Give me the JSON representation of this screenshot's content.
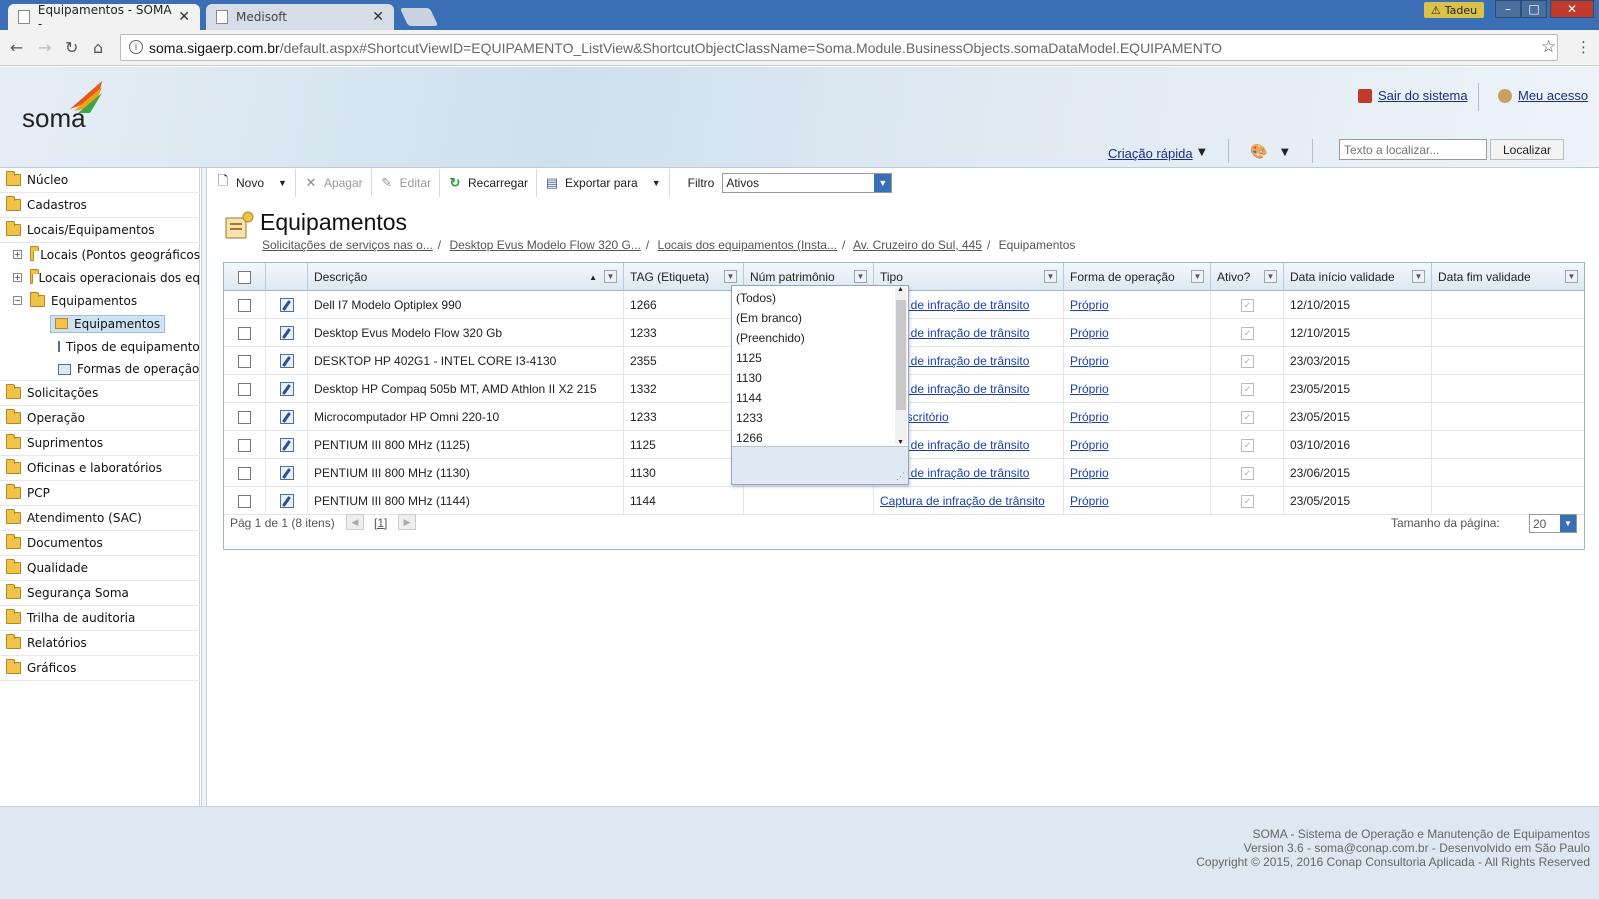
{
  "browser": {
    "tabs": [
      {
        "title": "Equipamentos - SOMA -",
        "close": "✕"
      },
      {
        "title": "Medisoft",
        "close": "✕"
      }
    ],
    "user": "Tadeu",
    "url_host": "soma.sigaerp.com.br",
    "url_path": "/default.aspx#ShortcutViewID=EQUIPAMENTO_ListView&ShortcutObjectClassName=Soma.Module.BusinessObjects.somaDataModel.EQUIPAMENTO"
  },
  "header": {
    "logo": "soma",
    "logout": "Sair do sistema",
    "my_access": "Meu acesso",
    "quick_create": "Criação rápida",
    "search_placeholder": "Texto a localizar...",
    "find_button": "Localizar"
  },
  "sidebar": {
    "items": [
      {
        "label": "Núcleo"
      },
      {
        "label": "Cadastros"
      },
      {
        "label": "Locais/Equipamentos"
      },
      {
        "label": "Locais (Pontos geográficos"
      },
      {
        "label": "Locais operacionais dos eq"
      },
      {
        "label": "Equipamentos"
      },
      {
        "label": "Equipamentos"
      },
      {
        "label": "Tipos de equipamentos"
      },
      {
        "label": "Formas de operação"
      },
      {
        "label": "Solicitações"
      },
      {
        "label": "Operação"
      },
      {
        "label": "Suprimentos"
      },
      {
        "label": "Oficinas e laboratórios"
      },
      {
        "label": "PCP"
      },
      {
        "label": "Atendimento (SAC)"
      },
      {
        "label": "Documentos"
      },
      {
        "label": "Qualidade"
      },
      {
        "label": "Segurança Soma"
      },
      {
        "label": "Trilha de auditoria"
      },
      {
        "label": "Relatórios"
      },
      {
        "label": "Gráficos"
      }
    ]
  },
  "toolbar": {
    "new": "Novo",
    "delete": "Apagar",
    "edit": "Editar",
    "reload": "Recarregar",
    "export": "Exportar para",
    "filter_label": "Filtro",
    "filter_value": "Ativos"
  },
  "page": {
    "title": "Equipamentos",
    "breadcrumbs": [
      "Solicitações de serviços nas o...",
      "Desktop Evus Modelo Flow 320 G...",
      "Locais dos equipamentos (Insta...",
      "Av. Cruzeiro do Sul, 445"
    ],
    "breadcrumb_current": "Equipamentos"
  },
  "grid": {
    "columns": [
      "Descrição",
      "TAG (Etiqueta)",
      "Núm patrimônio",
      "Tipo",
      "Forma de operação",
      "Ativo?",
      "Data início validade",
      "Data fim validade"
    ],
    "rows": [
      {
        "desc": "Dell I7 Modelo Optiplex 990",
        "tag": "1266",
        "tipo": "ptura de infração de trânsito",
        "forma": "Próprio",
        "inicio": "12/10/2015"
      },
      {
        "desc": "Desktop Evus Modelo Flow 320 Gb",
        "tag": "1233",
        "tipo": "ptura de infração de trânsito",
        "forma": "Próprio",
        "inicio": "12/10/2015"
      },
      {
        "desc": "DESKTOP HP 402G1 - INTEL CORE I3-4130",
        "tag": "2355",
        "tipo": "ptura de infração de trânsito",
        "forma": "Próprio",
        "inicio": "23/03/2015"
      },
      {
        "desc": "Desktop HP Compaq 505b MT, AMD Athlon II X2 215",
        "tag": "1332",
        "tipo": "ptura de infração de trânsito",
        "forma": "Próprio",
        "inicio": "23/05/2015"
      },
      {
        "desc": "Microcomputador HP Omni 220-10",
        "tag": "1233",
        "tipo": "em escritório",
        "forma": "Próprio",
        "inicio": "23/05/2015"
      },
      {
        "desc": "PENTIUM III 800 MHz (1125)",
        "tag": "1125",
        "tipo": "ptura de infração de trânsito",
        "forma": "Próprio",
        "inicio": "03/10/2016"
      },
      {
        "desc": "PENTIUM III 800 MHz (1130)",
        "tag": "1130",
        "tipo": "ptura de infração de trânsito",
        "forma": "Próprio",
        "inicio": "23/06/2015"
      },
      {
        "desc": "PENTIUM III 800 MHz (1144)",
        "tag": "1144",
        "tipo": "Captura de infração de trânsito",
        "forma": "Próprio",
        "inicio": "23/05/2015"
      }
    ],
    "pager_text": "Pág 1 de 1 (8 itens)",
    "current_page": "[1]",
    "page_size_label": "Tamanho da página:",
    "page_size": "20"
  },
  "tag_filter_dropdown": [
    "(Todos)",
    "(Em branco)",
    "(Preenchido)",
    "1125",
    "1130",
    "1144",
    "1233",
    "1266"
  ],
  "footer": {
    "line1": "SOMA - Sistema de Operação e Manutenção de Equipamentos",
    "line2": "Version 3.6 - soma@conap.com.br - Desenvolvido em São Paulo",
    "line3": "Copyright © 2015, 2016 Conap Consultoria Aplicada - All Rights Reserved"
  }
}
